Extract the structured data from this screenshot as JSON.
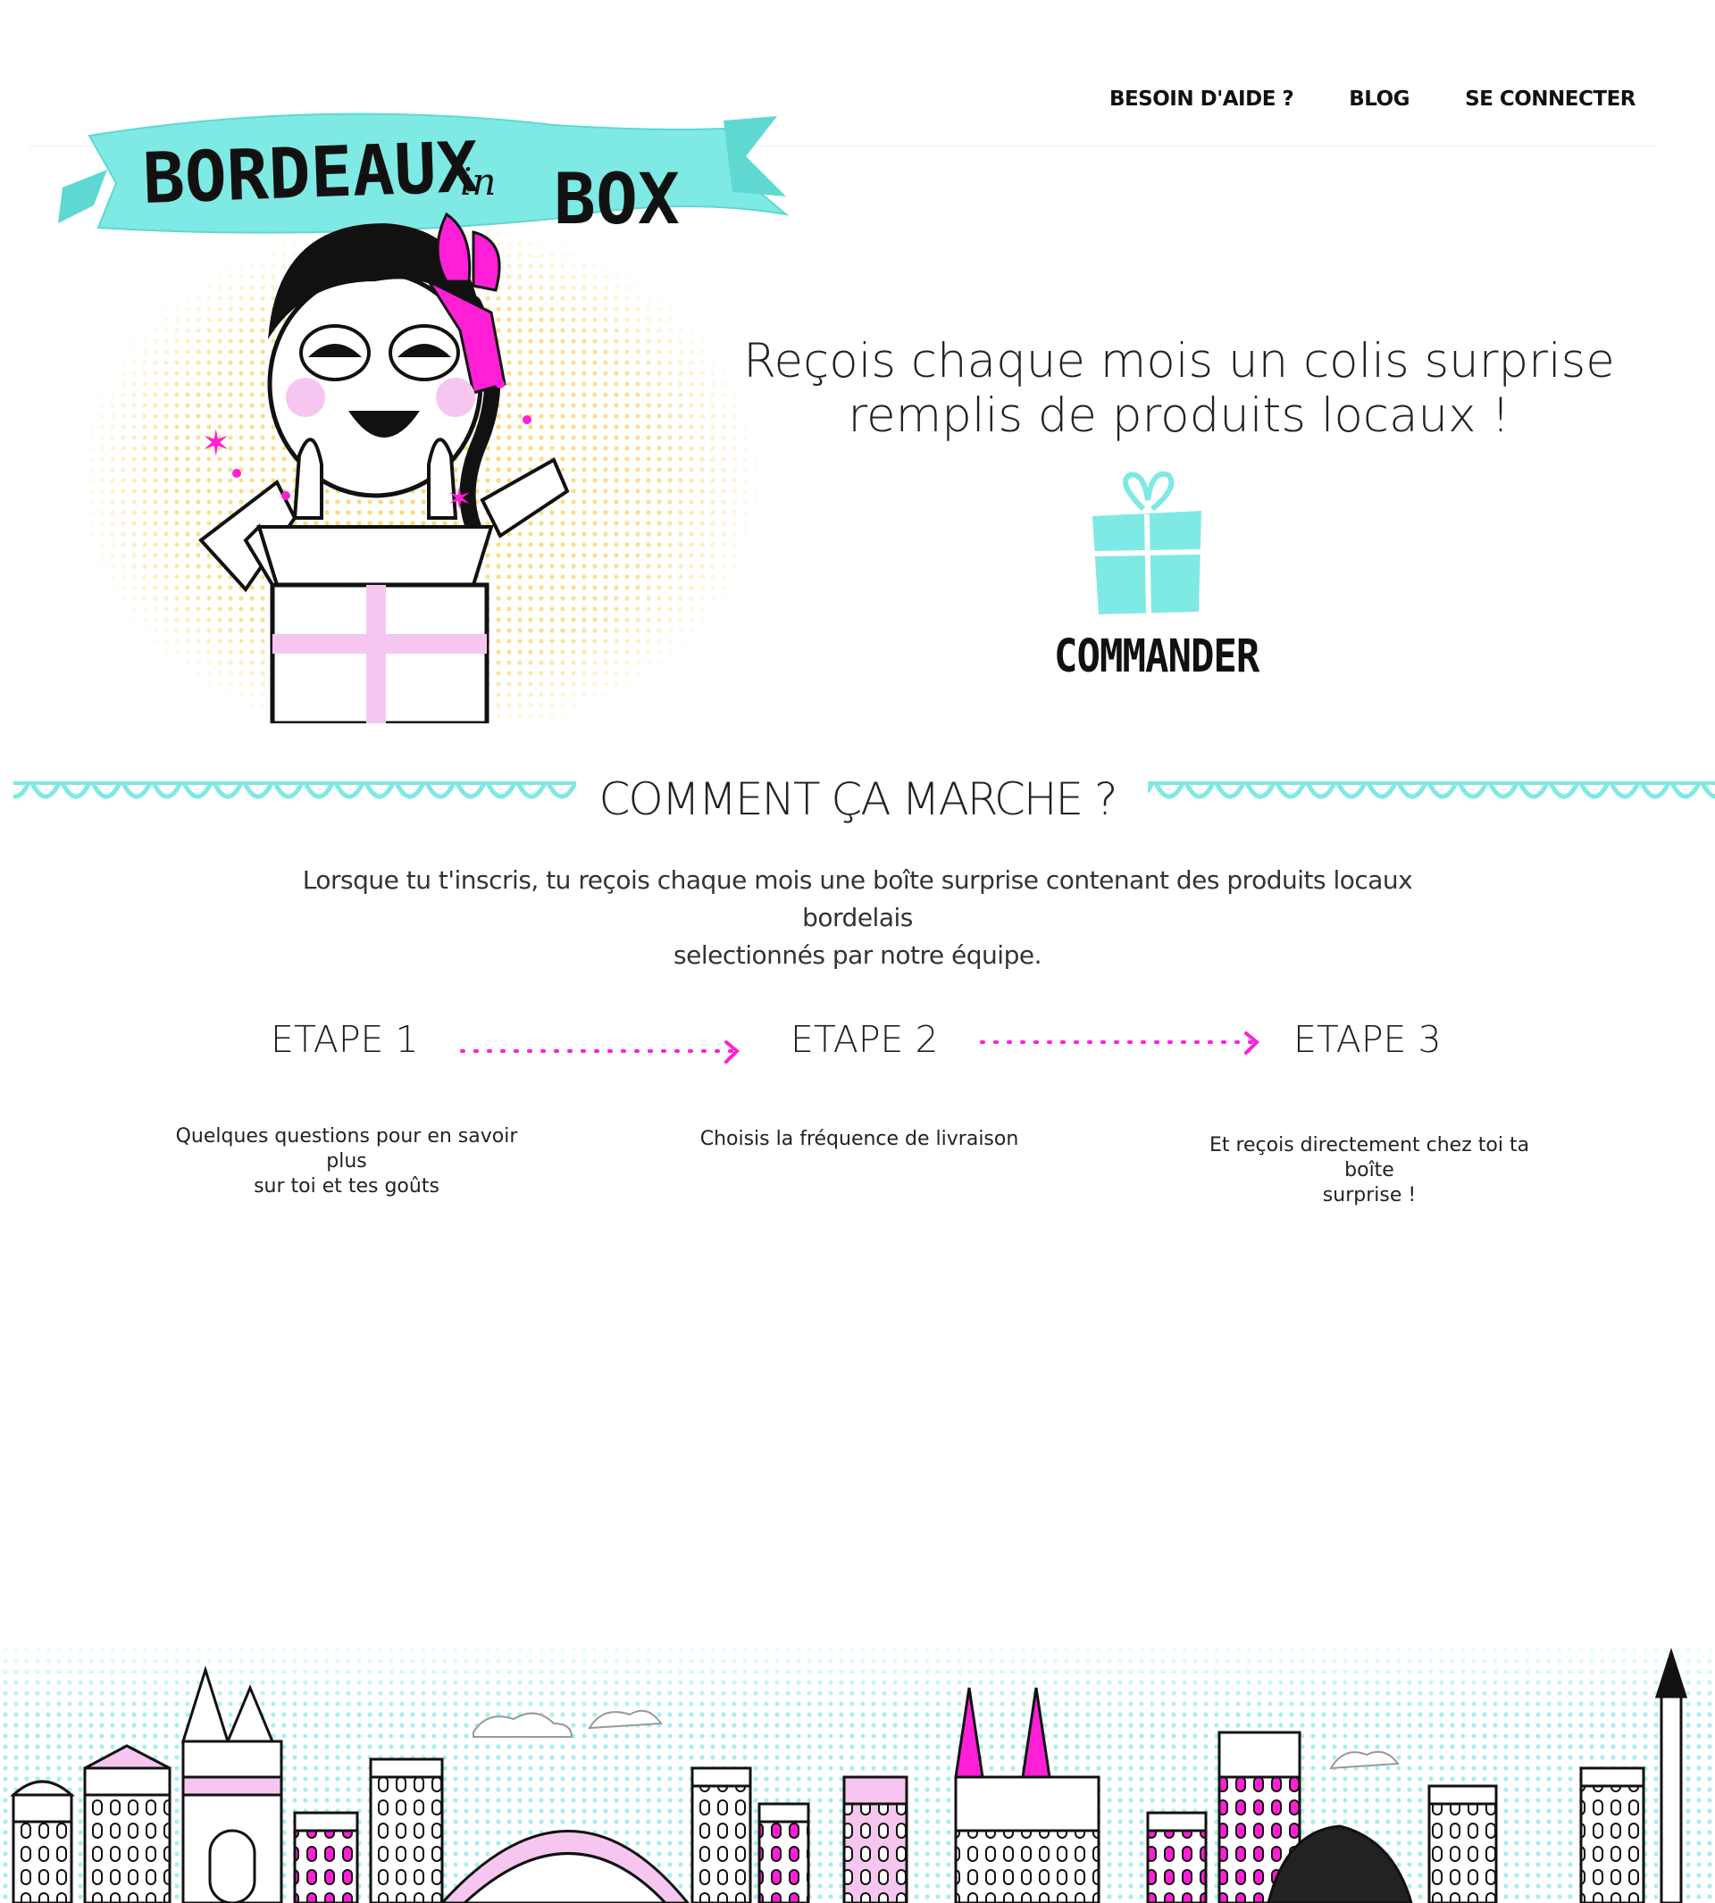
{
  "brand": {
    "word1": "BORDEAUX",
    "word2": "in",
    "word3": "BOX"
  },
  "nav": {
    "help": "BESOIN D'AIDE ?",
    "blog": "BLOG",
    "login": "SE CONNECTER"
  },
  "hero": {
    "tagline_line1": "Reçois chaque mois un colis surprise",
    "tagline_line2": "remplis de produits locaux !",
    "order_label": "COMMANDER"
  },
  "how": {
    "title": "COMMENT ÇA MARCHE ?",
    "intro_line1": "Lorsque tu t'inscris, tu reçois chaque mois une boîte surprise contenant des produits locaux bordelais",
    "intro_line2": "selectionnés par notre équipe."
  },
  "steps": [
    {
      "title": "ETAPE 1",
      "desc_line1": "Quelques questions pour en savoir plus",
      "desc_line2": "sur toi et tes goûts"
    },
    {
      "title": "ETAPE 2",
      "desc_line1": "Choisis la fréquence de livraison",
      "desc_line2": ""
    },
    {
      "title": "ETAPE 3",
      "desc_line1": "Et reçois directement chez toi ta boîte",
      "desc_line2": "surprise !"
    }
  ],
  "colors": {
    "turquoise": "#7fe9e4",
    "magenta": "#ff1fd6",
    "pink_light": "#f6c6f0",
    "dots_yellow": "#f4dc7a",
    "ink": "#111111"
  }
}
